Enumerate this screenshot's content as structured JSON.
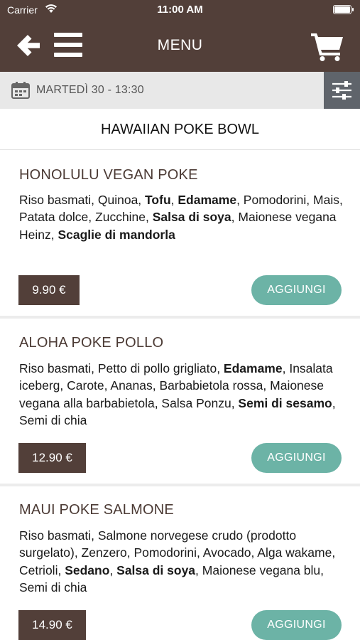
{
  "status_bar": {
    "carrier": "Carrier",
    "time": "11:00 AM",
    "battery_level": 1.0
  },
  "header": {
    "title": "MENU",
    "icons": [
      "back-arrow-icon",
      "hamburger-menu-icon",
      "cart-icon"
    ]
  },
  "date_bar": {
    "icon": "calendar-icon",
    "text": "MARTEDÌ 30 - 13:30",
    "filter_icon": "sliders-icon"
  },
  "category": {
    "title": "HAWAIIAN POKE BOWL"
  },
  "colors": {
    "header_bg": "#523f39",
    "price_bg": "#523f39",
    "add_button": "#6cb3a6",
    "date_bar_bg": "#e8e8e8",
    "filter_bg": "#5f646b"
  },
  "items": [
    {
      "name": "HONOLULU VEGAN POKE",
      "ingredients": [
        {
          "t": "Riso basmati, Quinoa, ",
          "b": false
        },
        {
          "t": "Tofu",
          "b": true
        },
        {
          "t": ", ",
          "b": false
        },
        {
          "t": "Edamame",
          "b": true
        },
        {
          "t": ", Pomodorini, Mais, Patata dolce, Zucchine, ",
          "b": false
        },
        {
          "t": "Salsa di soya",
          "b": true
        },
        {
          "t": ", Maionese vegana Heinz, ",
          "b": false
        },
        {
          "t": "Scaglie di mandorla",
          "b": true
        }
      ],
      "price": "9.90 €",
      "add_label": "AGGIUNGI"
    },
    {
      "name": "ALOHA POKE POLLO",
      "ingredients": [
        {
          "t": "Riso basmati, Petto di pollo grigliato, ",
          "b": false
        },
        {
          "t": "Edamame",
          "b": true
        },
        {
          "t": ", Insalata iceberg, Carote, Ananas, Barbabietola rossa, Maionese vegana alla barbabietola, Salsa Ponzu, ",
          "b": false
        },
        {
          "t": "Semi di sesamo",
          "b": true
        },
        {
          "t": ", Semi di chia",
          "b": false
        }
      ],
      "price": "12.90 €",
      "add_label": "AGGIUNGI"
    },
    {
      "name": "MAUI POKE SALMONE",
      "ingredients": [
        {
          "t": "Riso basmati, Salmone norvegese crudo (prodotto surgelato), Zenzero, Pomodorini, Avocado, Alga wakame, Cetrioli, ",
          "b": false
        },
        {
          "t": "Sedano",
          "b": true
        },
        {
          "t": ", ",
          "b": false
        },
        {
          "t": "Salsa di soya",
          "b": true
        },
        {
          "t": ", Maionese vegana blu, Semi di chia",
          "b": false
        }
      ],
      "price": "14.90 €",
      "add_label": "AGGIUNGI"
    }
  ]
}
